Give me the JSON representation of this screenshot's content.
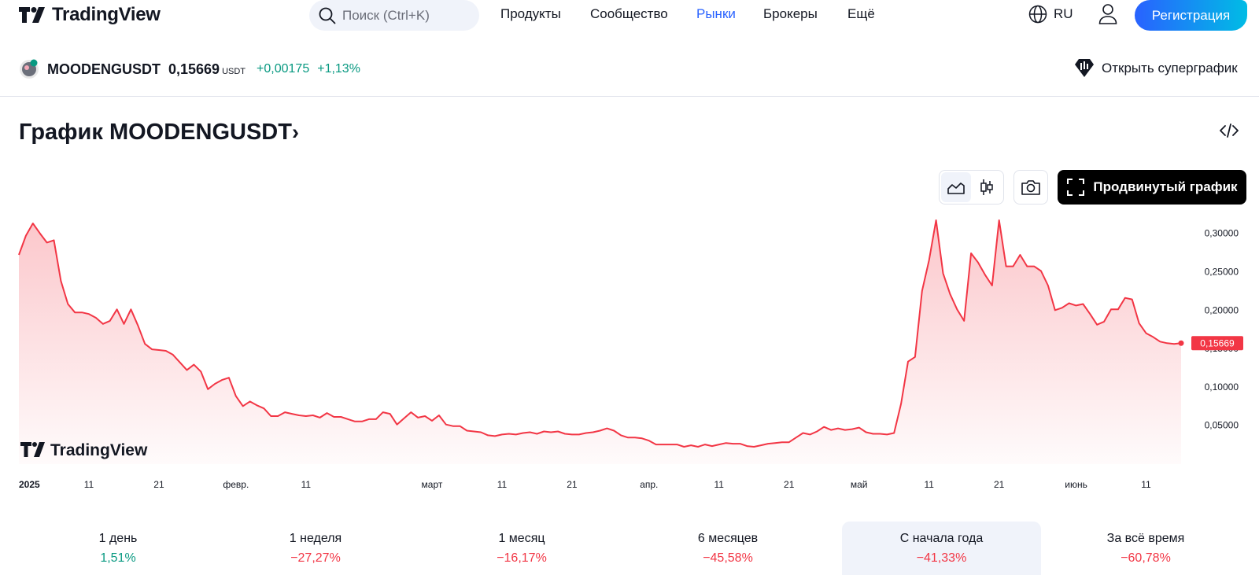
{
  "header": {
    "logo_text": "TradingView",
    "search_placeholder": "Поиск (Ctrl+K)",
    "nav": [
      {
        "label": "Продукты",
        "active": false
      },
      {
        "label": "Сообщество",
        "active": false
      },
      {
        "label": "Рынки",
        "active": true
      },
      {
        "label": "Брокеры",
        "active": false
      },
      {
        "label": "Ещё",
        "active": false
      }
    ],
    "language": "RU",
    "register_label": "Регистрация"
  },
  "symbol": {
    "name": "MOODENGUSDT",
    "price": "0,15669",
    "currency": "USDT",
    "change_abs": "+0,00175",
    "change_pct": "+1,13%",
    "supergraph_label": "Открыть суперграфик"
  },
  "title": "График MOODENGUSDT",
  "toolbar": {
    "advanced_label": "Продвинутый график"
  },
  "watermark": "TradingView",
  "chart_data": {
    "type": "area",
    "title": "",
    "price_label": "0,15669",
    "y_ticks": [
      "0,30000",
      "0,25000",
      "0,20000",
      "0,15000",
      "0,10000",
      "0,05000"
    ],
    "x_ticks": [
      {
        "label": "2025",
        "day": 0
      },
      {
        "label": "11",
        "day": 10
      },
      {
        "label": "21",
        "day": 20
      },
      {
        "label": "февр.",
        "day": 31
      },
      {
        "label": "11",
        "day": 41
      },
      {
        "label": "март",
        "day": 59
      },
      {
        "label": "11",
        "day": 69
      },
      {
        "label": "21",
        "day": 79
      },
      {
        "label": "апр.",
        "day": 90
      },
      {
        "label": "11",
        "day": 100
      },
      {
        "label": "21",
        "day": 110
      },
      {
        "label": "май",
        "day": 120
      },
      {
        "label": "11",
        "day": 130
      },
      {
        "label": "21",
        "day": 140
      },
      {
        "label": "июнь",
        "day": 151
      },
      {
        "label": "11",
        "day": 161
      }
    ],
    "ylim": [
      0.02,
      0.315
    ],
    "series": [
      {
        "values": [
          0.272,
          0.297,
          0.313,
          0.3,
          0.288,
          0.291,
          0.238,
          0.208,
          0.197,
          0.197,
          0.195,
          0.19,
          0.182,
          0.186,
          0.201,
          0.182,
          0.201,
          0.18,
          0.156,
          0.149,
          0.148,
          0.147,
          0.142,
          0.132,
          0.122,
          0.129,
          0.12,
          0.097,
          0.104,
          0.109,
          0.112,
          0.088,
          0.075,
          0.081,
          0.076,
          0.072,
          0.062,
          0.062,
          0.067,
          0.065,
          0.063,
          0.062,
          0.063,
          0.06,
          0.066,
          0.061,
          0.061,
          0.058,
          0.055,
          0.055,
          0.058,
          0.058,
          0.067,
          0.065,
          0.051,
          0.059,
          0.067,
          0.06,
          0.062,
          0.056,
          0.063,
          0.051,
          0.049,
          0.049,
          0.043,
          0.042,
          0.041,
          0.037,
          0.036,
          0.038,
          0.039,
          0.038,
          0.04,
          0.041,
          0.039,
          0.042,
          0.041,
          0.042,
          0.039,
          0.038,
          0.038,
          0.04,
          0.041,
          0.043,
          0.046,
          0.043,
          0.037,
          0.034,
          0.034,
          0.033,
          0.03,
          0.025,
          0.025,
          0.025,
          0.025,
          0.022,
          0.024,
          0.022,
          0.025,
          0.023,
          0.025,
          0.027,
          0.026,
          0.026,
          0.023,
          0.022,
          0.024,
          0.026,
          0.027,
          0.028,
          0.028,
          0.034,
          0.04,
          0.038,
          0.042,
          0.048,
          0.044,
          0.046,
          0.044,
          0.045,
          0.047,
          0.041,
          0.039,
          0.039,
          0.038,
          0.04,
          0.078,
          0.133,
          0.139,
          0.225,
          0.265,
          0.317,
          0.248,
          0.221,
          0.201,
          0.186,
          0.274,
          0.262,
          0.246,
          0.232,
          0.317,
          0.257,
          0.257,
          0.272,
          0.257,
          0.257,
          0.251,
          0.232,
          0.2,
          0.203,
          0.209,
          0.206,
          0.208,
          0.195,
          0.181,
          0.185,
          0.201,
          0.201,
          0.216,
          0.214,
          0.183,
          0.17,
          0.165,
          0.159,
          0.157,
          0.156,
          0.157
        ]
      }
    ]
  },
  "stats": [
    {
      "label": "1 день",
      "value": "1,51%",
      "sign": "pos",
      "selected": false
    },
    {
      "label": "1 неделя",
      "value": "−27,27%",
      "sign": "neg",
      "selected": false
    },
    {
      "label": "1 месяц",
      "value": "−16,17%",
      "sign": "neg",
      "selected": false
    },
    {
      "label": "6 месяцев",
      "value": "−45,58%",
      "sign": "neg",
      "selected": false
    },
    {
      "label": "С начала года",
      "value": "−41,33%",
      "sign": "neg",
      "selected": true
    },
    {
      "label": "За всё время",
      "value": "−60,78%",
      "sign": "neg",
      "selected": false
    }
  ],
  "colors": {
    "accent": "#2962ff",
    "line": "#f23645",
    "positive": "#089981",
    "negative": "#f23645"
  }
}
